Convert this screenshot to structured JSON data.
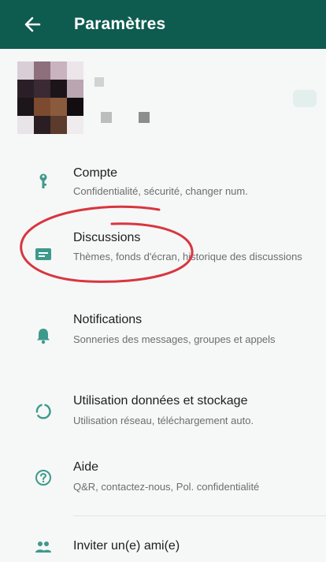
{
  "appbar": {
    "title": "Paramètres",
    "back_icon": "arrow-left-icon",
    "background": "#0e5b4f"
  },
  "accent_color": "#3d9a8b",
  "annotation_color": "#d8363f",
  "settings": [
    {
      "id": "compte",
      "icon": "key-icon",
      "title": "Compte",
      "subtitle": "Confidentialité, sécurité, changer num."
    },
    {
      "id": "discussions",
      "icon": "chat-icon",
      "title": "Discussions",
      "subtitle": "Thèmes, fonds d'écran, historique des discussions"
    },
    {
      "id": "notifications",
      "icon": "bell-icon",
      "title": "Notifications",
      "subtitle": "Sonneries des messages, groupes et appels"
    },
    {
      "id": "stockage",
      "icon": "data-usage-icon",
      "title": "Utilisation données et stockage",
      "subtitle": "Utilisation réseau, téléchargement auto."
    },
    {
      "id": "aide",
      "icon": "help-icon",
      "title": "Aide",
      "subtitle": "Q&R, contactez-nous, Pol. confidentialité"
    },
    {
      "id": "inviter",
      "icon": "group-icon",
      "title": "Inviter un(e) ami(e)"
    }
  ]
}
